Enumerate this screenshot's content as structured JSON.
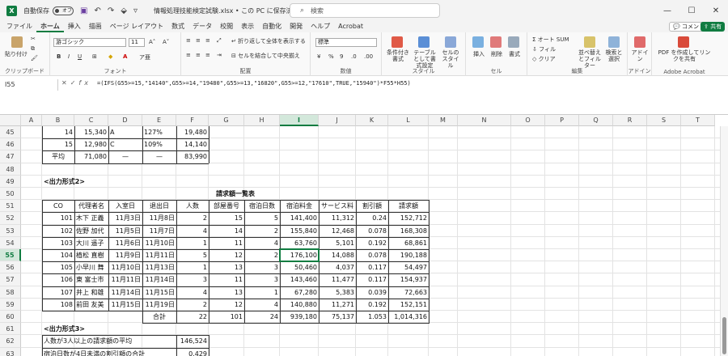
{
  "titlebar": {
    "autosave_label": "自動保存",
    "autosave_state": "オフ",
    "doc_title": "情報処理技能検定試験.xlsx • この PC に保存済み ⌄",
    "search_placeholder": "検索",
    "minimize": "—",
    "maximize": "☐",
    "close": "✕"
  },
  "menu": {
    "tabs": [
      "ファイル",
      "ホーム",
      "挿入",
      "描画",
      "ページ レイアウト",
      "数式",
      "データ",
      "校閲",
      "表示",
      "自動化",
      "開発",
      "ヘルプ",
      "Acrobat"
    ],
    "comment": "コメント",
    "share": "共有"
  },
  "ribbon": {
    "paste": "貼り付け",
    "clipboard": "クリップボード",
    "font_name": "游ゴシック",
    "font_size": "11",
    "font_group": "フォント",
    "wrap_text": "折り返して全体を表示する",
    "merge_center": "セルを結合して中央揃え",
    "align_group": "配置",
    "number_format": "標準",
    "number_group": "数値",
    "cond_format": "条件付き書式",
    "table_format": "テーブルとして書式設定",
    "cell_styles": "セルのスタイル",
    "styles_group": "スタイル",
    "insert": "挿入",
    "delete": "削除",
    "format": "書式",
    "cells_group": "セル",
    "autosum": "オート SUM",
    "fill": "フィル",
    "clear": "クリア",
    "sort_filter": "並べ替えとフィルター",
    "find_select": "検索と選択",
    "editing_group": "編集",
    "addin": "アドイン",
    "addin_group": "アドイン",
    "pdf_create": "PDF を作成してリンクを共有",
    "acrobat_group": "Adobe Acrobat"
  },
  "formula_bar": {
    "name_box": "I55",
    "formula": "=(IFS(G55>=15,\"14140\",G55>=14,\"19480\",G55>=13,\"16820\",G55>=12,\"17610\",TRUE,\"15940\")*F55*H55)"
  },
  "sheet": {
    "columns": [
      "A",
      "B",
      "C",
      "D",
      "E",
      "F",
      "G",
      "H",
      "I",
      "J",
      "K",
      "L",
      "M",
      "N",
      "O",
      "P",
      "Q",
      "R",
      "S",
      "T"
    ],
    "rows": [
      "45",
      "46",
      "47",
      "48",
      "49",
      "50",
      "51",
      "52",
      "53",
      "54",
      "55",
      "56",
      "57",
      "58",
      "59",
      "60",
      "61",
      "62",
      "63"
    ],
    "top_table": [
      [
        "14",
        "15,340",
        "A",
        "127%",
        "19,480"
      ],
      [
        "15",
        "12,980",
        "C",
        "109%",
        "14,140"
      ],
      [
        "平均",
        "71,080",
        "—",
        "—",
        "83,990"
      ]
    ],
    "section2_title": "<出力形式2>",
    "table_title": "請求額一覧表",
    "headers": [
      "CO",
      "代理者名",
      "入室日",
      "退出日",
      "人数",
      "部屋番号",
      "宿泊日数",
      "宿泊料金",
      "サービス料",
      "割引額",
      "請求額"
    ],
    "data_rows": [
      [
        "101",
        "木下 正義",
        "11月3日",
        "11月8日",
        "2",
        "15",
        "5",
        "141,400",
        "11,312",
        "0.24",
        "152,712"
      ],
      [
        "102",
        "佐野 加代",
        "11月5日",
        "11月7日",
        "4",
        "14",
        "2",
        "155,840",
        "12,468",
        "0.078",
        "168,308"
      ],
      [
        "103",
        "大川 遥子",
        "11月6日",
        "11月10日",
        "1",
        "11",
        "4",
        "63,760",
        "5,101",
        "0.192",
        "68,861"
      ],
      [
        "104",
        "植松 直樹",
        "11月9日",
        "11月11日",
        "5",
        "12",
        "2",
        "176,100",
        "14,088",
        "0.078",
        "190,188"
      ],
      [
        "105",
        "小早川 舞",
        "11月10日",
        "11月13日",
        "1",
        "13",
        "3",
        "50,460",
        "4,037",
        "0.117",
        "54,497"
      ],
      [
        "106",
        "東 富士市",
        "11月11日",
        "11月14日",
        "3",
        "11",
        "3",
        "143,460",
        "11,477",
        "0.117",
        "154,937"
      ],
      [
        "107",
        "井上 和雄",
        "11月14日",
        "11月15日",
        "4",
        "13",
        "1",
        "67,280",
        "5,383",
        "0.039",
        "72,663"
      ],
      [
        "108",
        "前田 友美",
        "11月15日",
        "11月19日",
        "2",
        "12",
        "4",
        "140,880",
        "11,271",
        "0.192",
        "152,151"
      ]
    ],
    "total_label": "合計",
    "total_row": [
      "22",
      "101",
      "24",
      "939,180",
      "75,137",
      "1.053",
      "1,014,316"
    ],
    "section3_title": "<出力形式3>",
    "q1_label": "人数が3人以上の請求額の平均",
    "q1_value": "146,524",
    "q2_label": "宿泊日数が4日未満の割引額の合計",
    "q2_value": "0.429"
  }
}
